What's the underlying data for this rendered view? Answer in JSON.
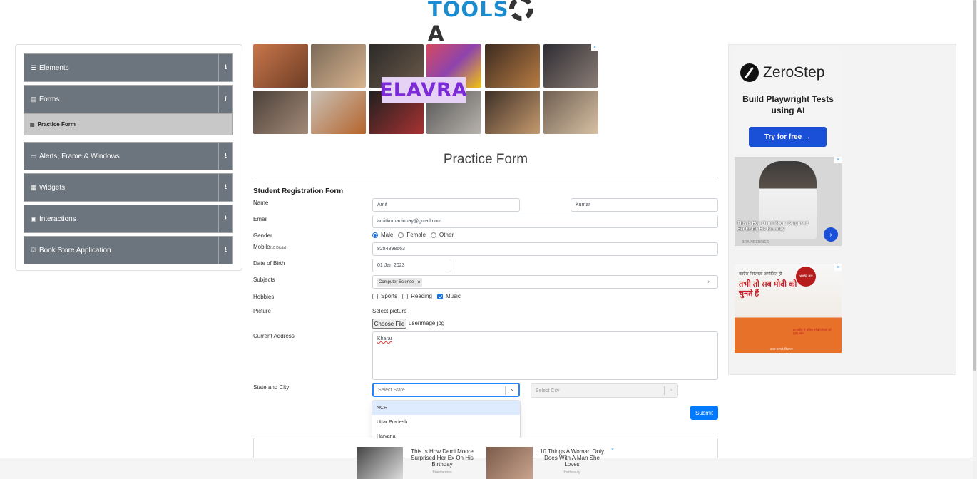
{
  "logo": {
    "part1": "TOOLS",
    "part2": "A"
  },
  "sidebar": {
    "groups": [
      {
        "icon": "☰",
        "label": "Elements",
        "toggle": "⭳"
      },
      {
        "icon": "▤",
        "label": "Forms",
        "toggle": "⭱"
      },
      {
        "icon": "▭",
        "label": "Alerts, Frame & Windows",
        "toggle": "⭳"
      },
      {
        "icon": "▦",
        "label": "Widgets",
        "toggle": "⭳"
      },
      {
        "icon": "▣",
        "label": "Interactions",
        "toggle": "⭳"
      },
      {
        "icon": "⛫",
        "label": "Book Store Application",
        "toggle": "⭳"
      }
    ],
    "active_item": {
      "icon": "▤",
      "label": "Practice Form"
    }
  },
  "ad_banner": {
    "brand": "ELAVRA"
  },
  "page": {
    "title": "Practice Form"
  },
  "form": {
    "heading": "Student Registration Form",
    "name_label": "Name",
    "first_name": "Amit",
    "last_name": "Kumar",
    "email_label": "Email",
    "email": "amitkumar.inbay@gmail.com",
    "gender_label": "Gender",
    "gender_options": [
      "Male",
      "Female",
      "Other"
    ],
    "gender_selected": "Male",
    "mobile_label": "Mobile",
    "mobile_hint": "(10 Digits)",
    "mobile": "8284898563",
    "dob_label": "Date of Birth",
    "dob": "01 Jan 2023",
    "subjects_label": "Subjects",
    "subjects": [
      "Computer Science"
    ],
    "subject_remove": "×",
    "subjects_clear": "×",
    "hobbies_label": "Hobbies",
    "hobbies": [
      {
        "label": "Sports",
        "checked": false
      },
      {
        "label": "Reading",
        "checked": false
      },
      {
        "label": "Music",
        "checked": true
      }
    ],
    "picture_label": "Picture",
    "select_picture": "Select picture",
    "choose_file": "Choose File",
    "file_name": "userimage.jpg",
    "address_label": "Current Address",
    "address": "Kharar",
    "state_city_label": "State and City",
    "state_placeholder": "Select State",
    "city_placeholder": "Select City",
    "state_options": [
      "NCR",
      "Uttar Pradesh",
      "Haryana"
    ],
    "submit": "Submit"
  },
  "right_ads": {
    "zerostep_brand": "ZeroStep",
    "zerostep_text": "Build Playwright Tests using AI",
    "zerostep_cta": "Try for free →",
    "demi_caption": "This Is How Demi Moore Surprised Her Ex On His Birthday",
    "demi_brand": "BRAINBERRIES",
    "hindi_line1": "कांग्रेस निरंतरता अयोजित ही",
    "hindi_line2": "तभी तो सब मोदी को चुनते हैं",
    "hindi_badge": "अबकी बार",
    "hindi_sub": "80 करोड़ से अधिक गरीब परिवारों को मुफ्त राशन",
    "hindi_foot": "प्रचार सामग्री, विज्ञापन"
  },
  "sticky_ad": {
    "left_text": "This Is How Demi Moore Surprised Her Ex On His Birthday",
    "left_brand": "Brainberries",
    "right_text": "10 Things A Woman Only Does With A Man She Loves",
    "right_brand": "Herbeauty"
  },
  "icons": {
    "close": "×",
    "chevron_down": "⌄",
    "arrow_right": "›"
  },
  "colors": {
    "accent": "#007bff",
    "sidebar": "#6c757d",
    "logo_blue": "#1d8ccf"
  }
}
